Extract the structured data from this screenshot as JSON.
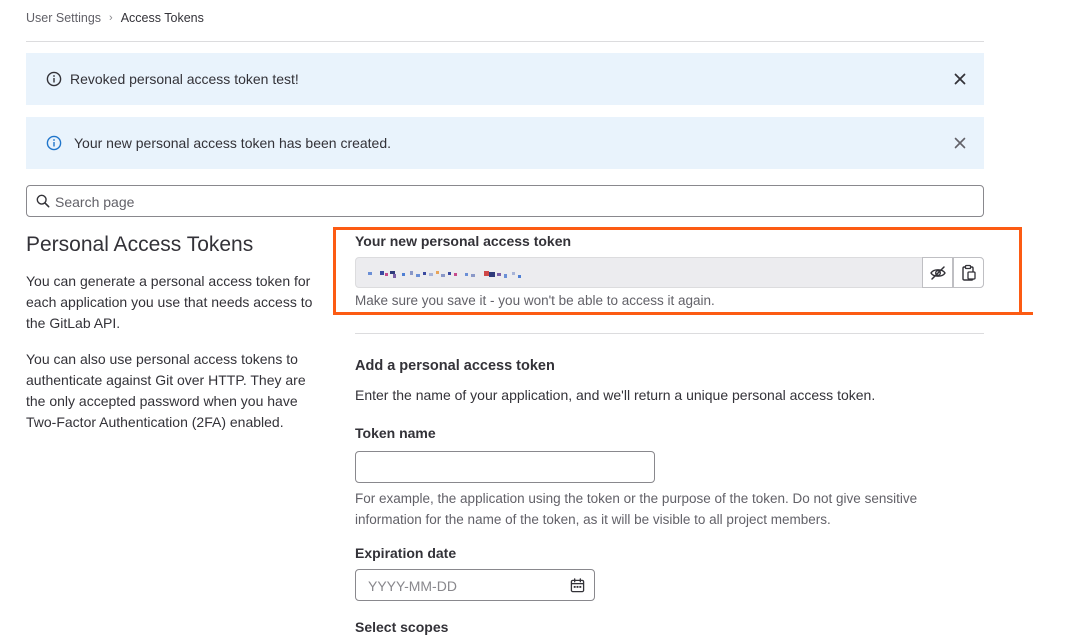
{
  "breadcrumb": {
    "parent": "User Settings",
    "current": "Access Tokens"
  },
  "alerts": [
    {
      "text": "Revoked personal access token test!"
    },
    {
      "text": "Your new personal access token has been created."
    }
  ],
  "search": {
    "placeholder": "Search page"
  },
  "intro": {
    "title": "Personal Access Tokens",
    "paragraph1": "You can generate a personal access token for each application you use that needs access to the GitLab API.",
    "paragraph2": "You can also use personal access tokens to authenticate against Git over HTTP. They are the only accepted password when you have Two-Factor Authentication (2FA) enabled."
  },
  "new_token": {
    "label": "Your new personal access token",
    "help": "Make sure you save it - you won't be able to access it again."
  },
  "form": {
    "title": "Add a personal access token",
    "description": "Enter the name of your application, and we'll return a unique personal access token.",
    "token_name_label": "Token name",
    "token_name_value": "",
    "token_name_help_line1": "For example, the application using the token or the purpose of the token. Do not give sensitive",
    "token_name_help_line2": "information for the name of the token, as it will be visible to all project members.",
    "expiration_label": "Expiration date",
    "expiration_placeholder": "YYYY-MM-DD",
    "scopes_label": "Select scopes"
  },
  "colors": {
    "alert_bg": "#e9f3fc",
    "info_blue": "#1f75cb",
    "highlight": "#fc5b13"
  }
}
